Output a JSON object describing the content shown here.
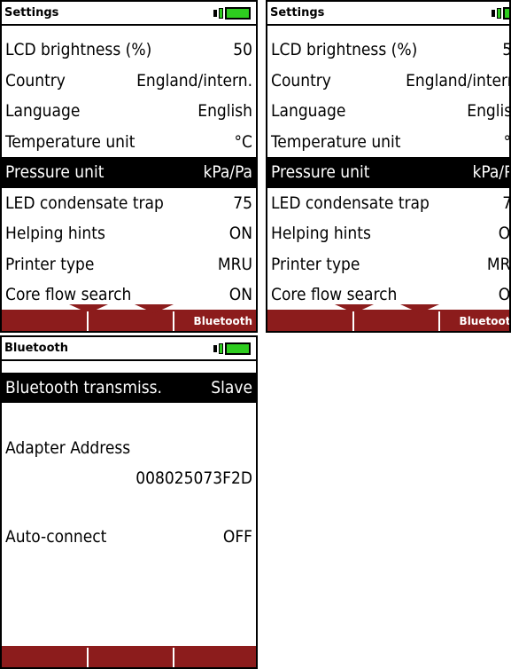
{
  "settings_screen": {
    "title": "Settings",
    "rows": [
      {
        "label": "LCD brightness (%)",
        "value": "50"
      },
      {
        "label": "Country",
        "value": "England/intern."
      },
      {
        "label": "Language",
        "value": "English"
      },
      {
        "label": "Temperature unit",
        "value": "°C"
      },
      {
        "label": "Pressure unit",
        "value": "kPa/Pa"
      },
      {
        "label": "LED condensate trap",
        "value": "75"
      },
      {
        "label": "Helping hints",
        "value": "ON"
      },
      {
        "label": "Printer type",
        "value": "MRU"
      },
      {
        "label": "Core flow search",
        "value": "ON"
      }
    ],
    "selected_row": "Pressure unit",
    "softkeys": [
      "",
      "",
      "Bluetooth"
    ]
  },
  "bluetooth_screen": {
    "title": "Bluetooth",
    "transmission_label": "Bluetooth transmiss.",
    "transmission_value": "Slave",
    "adapter_label": "Adapter Address",
    "adapter_value": "008025073F2D",
    "autoconnect_label": "Auto-connect",
    "autoconnect_value": "OFF",
    "softkeys": [
      "",
      "",
      ""
    ]
  },
  "colors": {
    "softkey_bar": "#8c1c1c",
    "battery": "#2ecc1f",
    "selection": "#000000"
  }
}
